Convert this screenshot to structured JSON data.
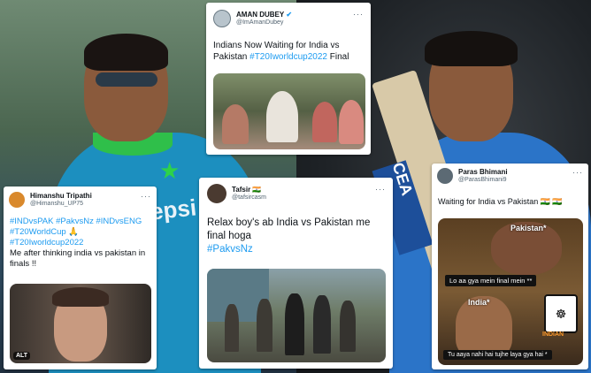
{
  "background": {
    "left_jersey_text": "epsi",
    "bat_label": "CEA"
  },
  "tweets": [
    {
      "name": "AMAN DUBEY",
      "verified": true,
      "handle": "@ImAmanDubey",
      "text_plain": "Indians Now Waiting for India vs Pakistan ",
      "hashtag": "#T20Iworldcup2022",
      "text_after": " Final"
    },
    {
      "name": "Himanshu Tripathi",
      "handle": "@Himanshu_UP75",
      "hashtags_line1": "#INDvsPAK #PakvsNz #INDvsENG",
      "hashtags_line2": "#T20WorldCup 🙏",
      "hashtags_line3": "#T20Iworldcup2022",
      "text": "Me after thinking india vs pakistan in finals !!",
      "alt_badge": "ALT"
    },
    {
      "name": "Tafsir 🇮🇳",
      "handle": "@tafsircasm",
      "text_line1": "Relax boy's ab India vs Pakistan me",
      "text_line2": "final hoga",
      "hashtag": "#PakvsNz"
    },
    {
      "name": "Paras Bhimani",
      "handle": "@ParasBhimani9",
      "text": "Waiting for India vs Pakistan 🇮🇳 🇮🇳",
      "meme_top": "Pakistan*",
      "meme_caption1": "Lo aa gya mein final mein **",
      "meme_mid": "India*",
      "meme_caption2": "Tu aaya nahi hai tujhe laya gya hai *",
      "meme_logo": "INDIAN"
    }
  ],
  "colors": {
    "link": "#1d9bf0",
    "verified": "#1d9bf0"
  }
}
